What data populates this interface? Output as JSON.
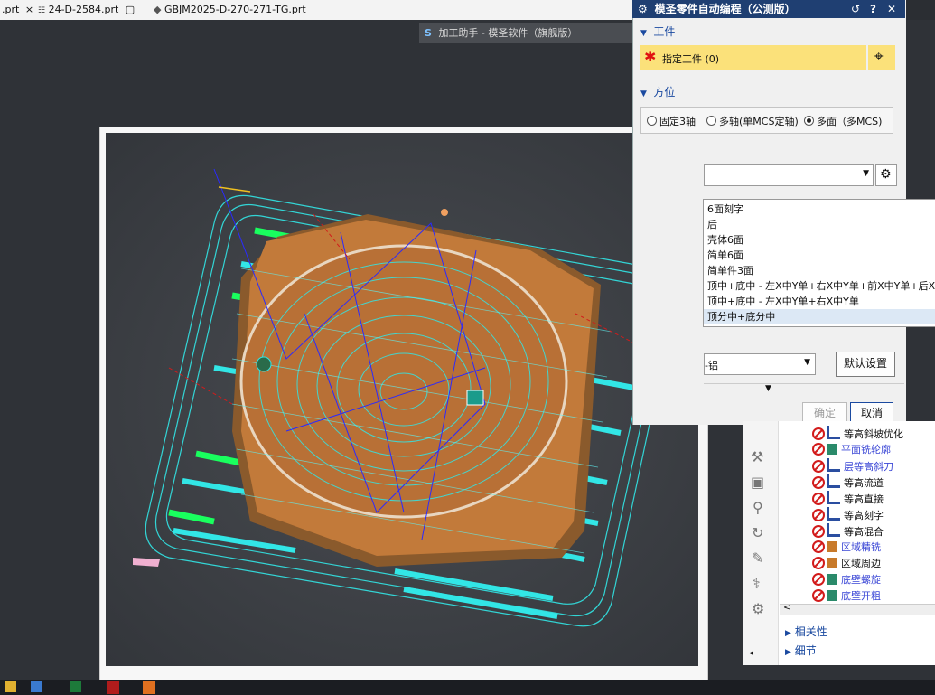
{
  "tabs": [
    {
      "label": ".prt",
      "close": "×"
    },
    {
      "label": "24-D-2584.prt"
    },
    {
      "label": "GBJM2025-D-270-271-TG.prt"
    }
  ],
  "helper_bar": {
    "title": "加工助手 - 模圣软件（旗舰版）"
  },
  "dialog": {
    "title": "模圣零件自动编程（公测版）",
    "title_icons": [
      "↺",
      "?",
      "✕"
    ],
    "section_workpiece": "工件",
    "specify_workpiece": "指定工件 (0)",
    "section_orientation": "方位",
    "orient_options": [
      {
        "label": "固定3轴",
        "selected": false
      },
      {
        "label": "多轴(单MCS定轴)",
        "selected": false
      },
      {
        "label": "多面（多MCS)",
        "selected": true
      }
    ],
    "material_value": "-铝",
    "default_settings": "默认设置",
    "confirm": "确定",
    "cancel": "取消"
  },
  "dropdown_items": [
    "6面刻字",
    "后",
    "壳体6面",
    "简单6面",
    "简单件3面",
    "顶中+底中 - 左X中Y单+右X中Y单+前X中Y单+后X中",
    "顶中+底中 - 左X中Y单+右X中Y单",
    "顶分中+底分中"
  ],
  "dropdown_selected_index": 7,
  "navigator": {
    "operations": [
      {
        "label": "等高斜坡优化",
        "link": false
      },
      {
        "label": "平面铣轮廓",
        "link": true
      },
      {
        "label": "层等高斜刀",
        "link": true
      },
      {
        "label": "等高流道",
        "link": false
      },
      {
        "label": "等高直接",
        "link": false
      },
      {
        "label": "等高刻字",
        "link": false
      },
      {
        "label": "等高混合",
        "link": false
      },
      {
        "label": "区域精铣",
        "link": true
      },
      {
        "label": "区域周边",
        "link": false
      },
      {
        "label": "底壁螺旋",
        "link": true
      },
      {
        "label": "底壁开粗",
        "link": true
      }
    ],
    "sections": [
      "相关性",
      "细节"
    ]
  },
  "colors": {
    "title_bar": "#1f3f72",
    "accent_yellow": "#fbe17a",
    "link_blue": "#3b47d6",
    "part_orange": "#c27a3a",
    "toolpath_cyan": "#32e6e6"
  }
}
